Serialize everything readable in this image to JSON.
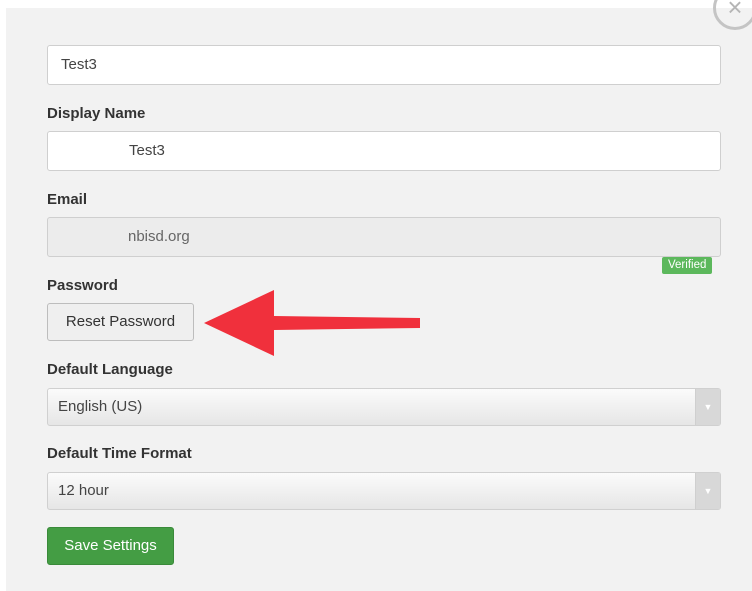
{
  "form": {
    "name_value": "Test3",
    "display_name_label": "Display Name",
    "display_name_value": "Test3",
    "email_label": "Email",
    "email_value": "nbisd.org",
    "verified_badge": "Verified",
    "password_label": "Password",
    "reset_password_button": "Reset Password",
    "language_label": "Default Language",
    "language_value": "English (US)",
    "time_format_label": "Default Time Format",
    "time_format_value": "12 hour",
    "save_button": "Save Settings"
  },
  "icons": {
    "close": "close-icon",
    "select_caret": "chevron-down-icon"
  },
  "colors": {
    "annotation_arrow": "#f0303c",
    "verified_badge": "#5cb85c",
    "save_button": "#449d44"
  }
}
